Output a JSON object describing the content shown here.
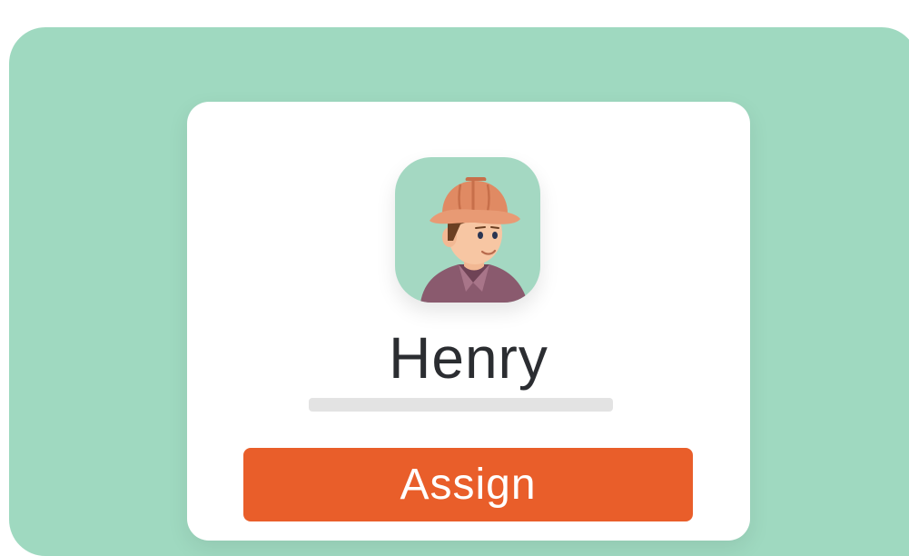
{
  "card": {
    "name": "Henry",
    "assign_label": "Assign",
    "avatar_icon": "worker-hardhat-avatar"
  },
  "colors": {
    "background": "#9fd9c0",
    "card": "#ffffff",
    "accent": "#e95e2a",
    "name_text": "#2b2d31",
    "placeholder_bar": "#e3e3e3"
  }
}
